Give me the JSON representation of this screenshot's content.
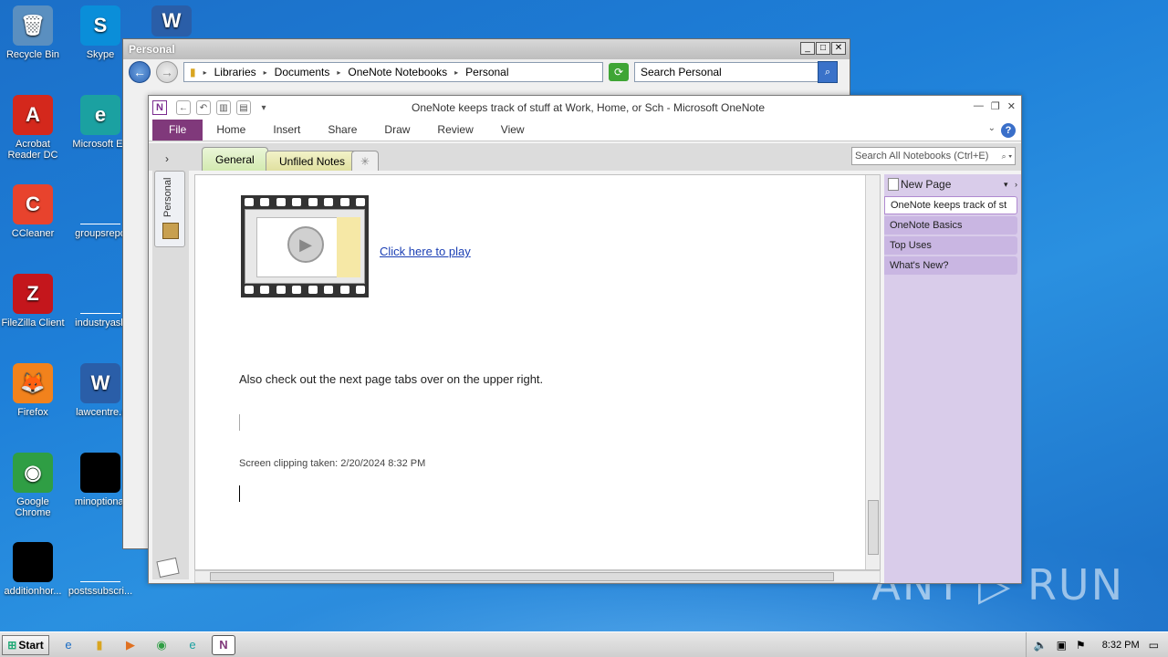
{
  "desktop": {
    "icons": [
      {
        "label": "Recycle Bin",
        "glyph": "🗑",
        "color": "#5a8fc0"
      },
      {
        "label": "Skype",
        "glyph": "S",
        "color": "#0a8ed9"
      },
      {
        "label": "Acrobat Reader DC",
        "glyph": "A",
        "color": "#d4281c"
      },
      {
        "label": "Microsoft Ed",
        "glyph": "e",
        "color": "#1ba1a1"
      },
      {
        "label": "CCleaner",
        "glyph": "C",
        "color": "#e8432d"
      },
      {
        "label": "groupsrepo",
        "glyph": "",
        "color": "#ffffff"
      },
      {
        "label": "FileZilla Client",
        "glyph": "Z",
        "color": "#c4161c"
      },
      {
        "label": "industryask",
        "glyph": "",
        "color": "#ffffff"
      },
      {
        "label": "Firefox",
        "glyph": "🦊",
        "color": "#f2821c"
      },
      {
        "label": "lawcentre.r",
        "glyph": "W",
        "color": "#2a5ea8"
      },
      {
        "label": "Google Chrome",
        "glyph": "◉",
        "color": "#2f9e44"
      },
      {
        "label": "minoptional",
        "glyph": "",
        "color": "#000000"
      },
      {
        "label": "additionhor...",
        "glyph": "",
        "color": "#000000"
      },
      {
        "label": "postssubscri...",
        "glyph": "",
        "color": "#ffffff"
      }
    ],
    "word_icon_glyph": "W"
  },
  "watermark": "ANY ▷ RUN",
  "explorer": {
    "title": "Personal",
    "breadcrumb": [
      "Libraries",
      "Documents",
      "OneNote Notebooks",
      "Personal"
    ],
    "search_placeholder": "Search Personal"
  },
  "onenote": {
    "title": "OneNote keeps track of stuff at Work, Home, or Sch  -  Microsoft OneNote",
    "ribbon_tabs": [
      "File",
      "Home",
      "Insert",
      "Share",
      "Draw",
      "Review",
      "View"
    ],
    "section_tabs": [
      "General",
      "Unfiled Notes"
    ],
    "search_placeholder": "Search All Notebooks (Ctrl+E)",
    "notebook_name": "Personal",
    "video_link": "Click here to play",
    "body_text": "Also check out the next page tabs over on the upper right.",
    "clip_text": "Screen clipping taken: 2/20/2024 8:32 PM",
    "new_page": "New Page",
    "pages": [
      "OneNote keeps track of st",
      "OneNote Basics",
      "Top Uses",
      "What's New?"
    ]
  },
  "taskbar": {
    "start_label": "Start",
    "clock": "8:32 PM"
  }
}
